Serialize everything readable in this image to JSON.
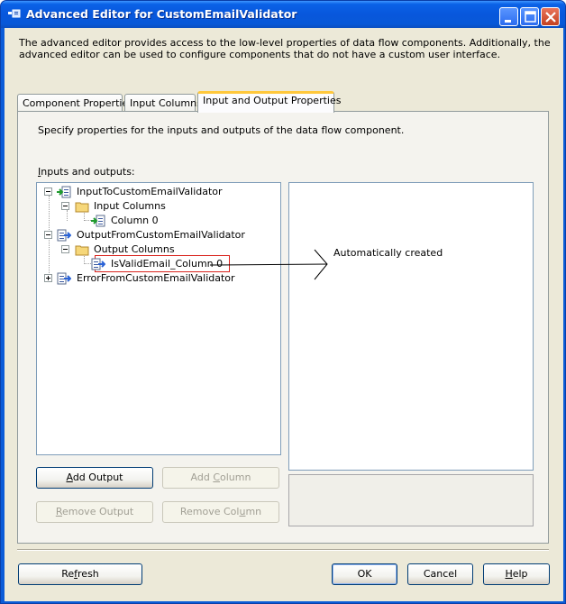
{
  "window": {
    "title": "Advanced Editor for CustomEmailValidator"
  },
  "description": "The advanced editor provides access to the low-level properties of data flow components. Additionally, the advanced editor can be used to configure components that do not have a custom user interface.",
  "tabs": [
    {
      "label": "Component Properties",
      "active": false
    },
    {
      "label": "Input Columns",
      "active": false
    },
    {
      "label": "Input and Output Properties",
      "active": true
    }
  ],
  "panel": {
    "instruction": "Specify properties for the inputs and outputs of the data flow component.",
    "io_label_first": "I",
    "io_label_rest": "nputs and outputs:"
  },
  "tree": {
    "items": [
      {
        "label": "InputToCustomEmailValidator",
        "icon": "input-icon",
        "expanded": true
      },
      {
        "label": "Input Columns",
        "icon": "folder-icon",
        "expanded": true
      },
      {
        "label": "Column 0",
        "icon": "column-icon"
      },
      {
        "label": "OutputFromCustomEmailValidator",
        "icon": "output-icon",
        "expanded": true
      },
      {
        "label": "Output Columns",
        "icon": "folder-icon",
        "expanded": true
      },
      {
        "label": "IsValidEmail_Column 0",
        "icon": "output-column-icon",
        "selected_highlight": true
      },
      {
        "label": "ErrorFromCustomEmailValidator",
        "icon": "output-icon",
        "expanded": false
      }
    ]
  },
  "annotation": "Automatically created",
  "buttons": {
    "add_output": {
      "pre": "",
      "key": "A",
      "post": "dd Output"
    },
    "add_column": {
      "pre": "Add ",
      "key": "C",
      "post": "olumn"
    },
    "remove_output": {
      "pre": "",
      "key": "R",
      "post": "emove Output"
    },
    "remove_column": {
      "pre": "Remove Col",
      "key": "u",
      "post": "mn"
    },
    "refresh": {
      "pre": "Re",
      "key": "f",
      "post": "resh"
    },
    "ok": "OK",
    "cancel": "Cancel",
    "help": {
      "pre": "",
      "key": "H",
      "post": "elp"
    }
  },
  "colors": {
    "titlebar": "#0858dc",
    "client": "#ece9d8",
    "highlight_border": "#d9221c",
    "active_tab_accent": "#ffc83c"
  }
}
